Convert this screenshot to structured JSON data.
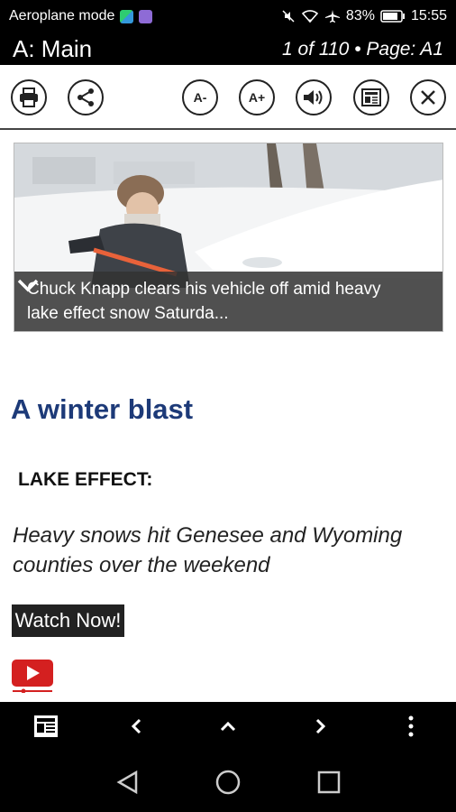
{
  "status_bar": {
    "mode_label": "Aeroplane mode",
    "battery": "83%",
    "time": "15:55"
  },
  "app_bar": {
    "section_title": "A: Main",
    "page_info": "1 of 110 • Page: A1"
  },
  "toolbar": {
    "text_smaller_label": "A-",
    "text_larger_label": "A+"
  },
  "article": {
    "image_caption": "Chuck Knapp clears his vehicle off amid heavy lake effect snow Saturda...",
    "headline": "A winter blast",
    "kicker": "LAKE EFFECT:",
    "deck": "Heavy snows hit Genesee and Wyoming counties over the weekend",
    "watch_label": "Watch Now!"
  }
}
